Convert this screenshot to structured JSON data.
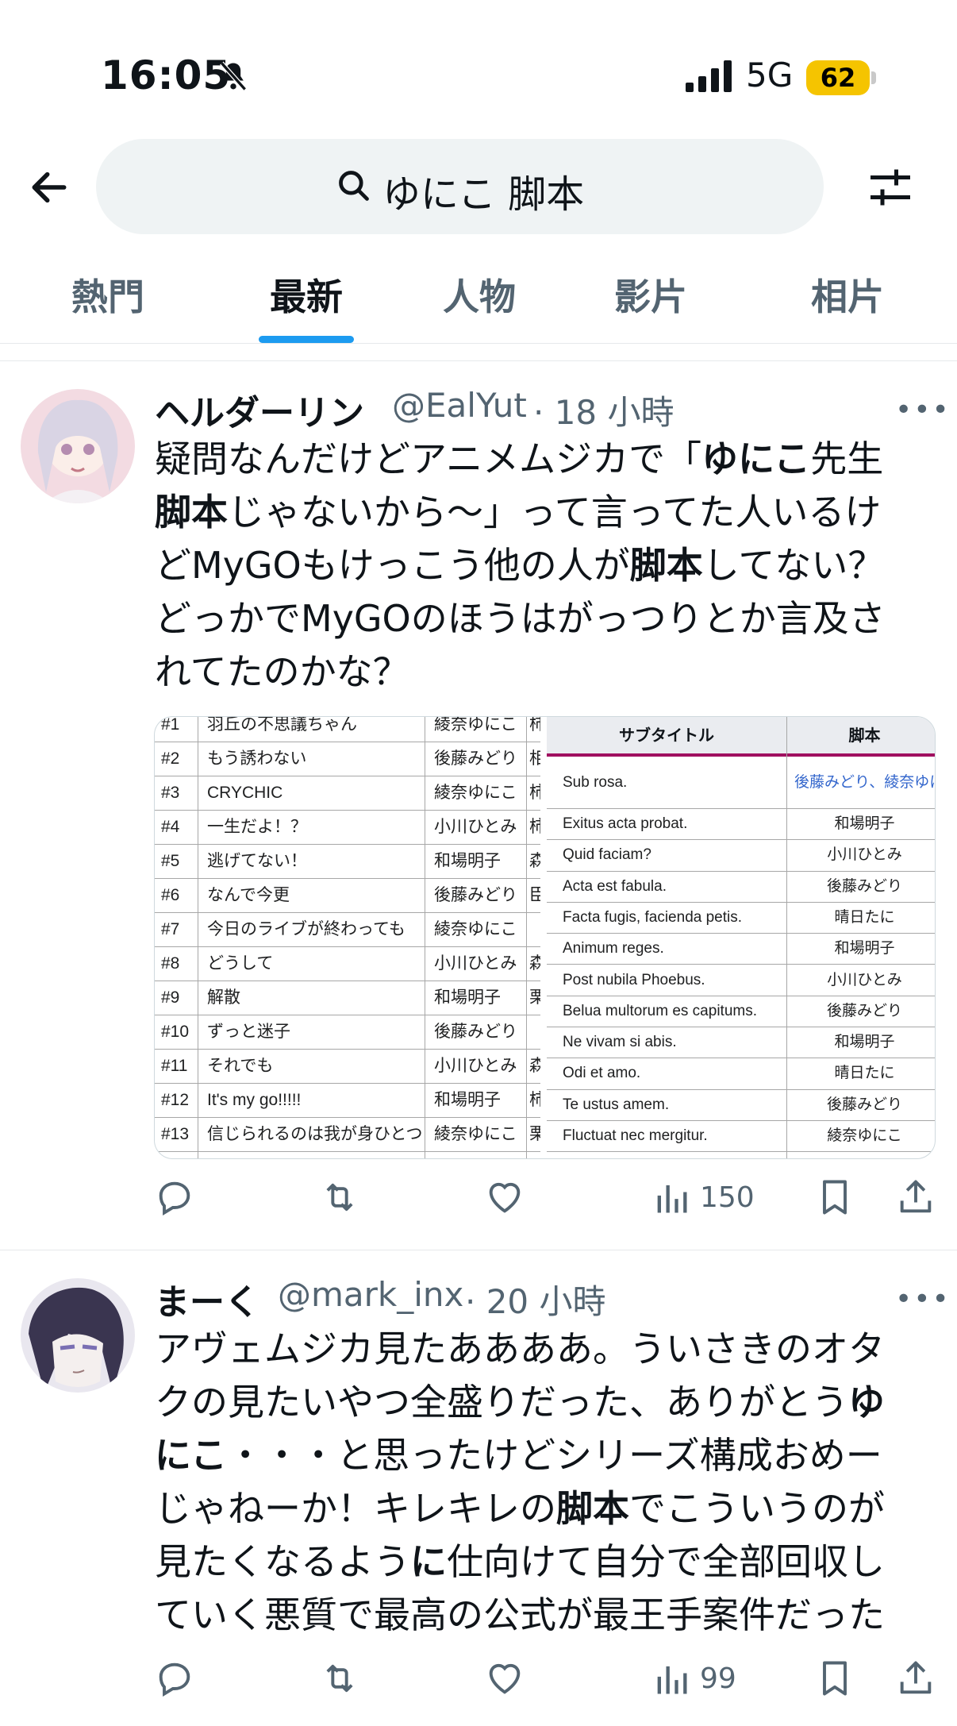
{
  "status_bar": {
    "time": "16:05",
    "network": "5G",
    "battery": "62"
  },
  "search": {
    "query": "ゆにこ 脚本"
  },
  "tabs": [
    {
      "label": "熱門"
    },
    {
      "label": "最新",
      "active": true
    },
    {
      "label": "人物"
    },
    {
      "label": "影片"
    },
    {
      "label": "相片"
    }
  ],
  "tweets": [
    {
      "name": "ヘルダーリン",
      "handle": "@EalYut",
      "time": "· 18 小時",
      "body_lines": [
        [
          {
            "t": "疑問なんだけどアニメムジカで「"
          },
          {
            "t": "ゆにこ",
            "b": true
          },
          {
            "t": "先生"
          }
        ],
        [
          {
            "t": "脚本",
            "b": true
          },
          {
            "t": "じゃないから～」って言ってた人いるけ"
          }
        ],
        [
          {
            "t": "どMyGOもけっこう他の人が"
          },
          {
            "t": "脚本",
            "b": true
          },
          {
            "t": "してない？"
          }
        ],
        [
          {
            "t": "どっかでMyGOのほうはがっつりとか言及さ"
          }
        ],
        [
          {
            "t": "れてたのかな？"
          }
        ]
      ],
      "views": "150",
      "media": {
        "left_table": [
          [
            "#1",
            "羽丘の不思議ちゃん",
            "綾奈ゆにこ",
            "柿"
          ],
          [
            "#2",
            "もう誘わない",
            "後藤みどり",
            "相"
          ],
          [
            "#3",
            "CRYCHIC",
            "綾奈ゆにこ",
            "柿"
          ],
          [
            "#4",
            "一生だよ！？",
            "小川ひとみ",
            "柿"
          ],
          [
            "#5",
            "逃げてない！",
            "和場明子",
            "森"
          ],
          [
            "#6",
            "なんで今更",
            "後藤みどり",
            "臣"
          ],
          [
            "#7",
            "今日のライブが終わっても",
            "綾奈ゆにこ",
            ""
          ],
          [
            "#8",
            "どうして",
            "小川ひとみ",
            "森"
          ],
          [
            "#9",
            "解散",
            "和場明子",
            "栗"
          ],
          [
            "#10",
            "ずっと迷子",
            "後藤みどり",
            ""
          ],
          [
            "#11",
            "それでも",
            "小川ひとみ",
            "森"
          ],
          [
            "#12",
            "It's my go!!!!!",
            "和場明子",
            "柿"
          ],
          [
            "#13",
            "信じられるのは我が身ひとつ",
            "綾奈ゆにこ",
            "栗"
          ]
        ],
        "right_table": {
          "headers": [
            "サブタイトル",
            "脚本"
          ],
          "rows": [
            [
              "Sub rosa.",
              "後藤みどり、綾奈ゆに"
            ],
            [
              "Exitus acta probat.",
              "和場明子"
            ],
            [
              "Quid faciam?",
              "小川ひとみ"
            ],
            [
              "Acta est fabula.",
              "後藤みどり"
            ],
            [
              "Facta fugis, facienda petis.",
              "晴日たに"
            ],
            [
              "Animum reges.",
              "和場明子"
            ],
            [
              "Post nubila Phoebus.",
              "小川ひとみ"
            ],
            [
              "Belua multorum es capitums.",
              "後藤みどり"
            ],
            [
              "Ne vivam si abis.",
              "和場明子"
            ],
            [
              "Odi et amo.",
              "晴日たに"
            ],
            [
              "Te ustus amem.",
              "後藤みどり"
            ],
            [
              "Fluctuat nec mergitur.",
              "綾奈ゆにこ"
            ]
          ]
        }
      }
    },
    {
      "name": "まーく",
      "handle": "@mark_inx",
      "time": "· 20 小時",
      "body_lines": [
        [
          {
            "t": "アヴェムジカ見たああああ。ういさきのオタ"
          }
        ],
        [
          {
            "t": "クの見たいやつ全盛りだった、ありがとう"
          },
          {
            "t": "ゆ",
            "b": true
          }
        ],
        [
          {
            "t": "にこ",
            "b": true
          },
          {
            "t": "・・・と思ったけどシリーズ構成おめー"
          }
        ],
        [
          {
            "t": "じゃねーか！キレキレの"
          },
          {
            "t": "脚本",
            "b": true
          },
          {
            "t": "でこういうのが"
          }
        ],
        [
          {
            "t": "見たくなるよう"
          },
          {
            "t": "に",
            "b": true
          },
          {
            "t": "仕向けて自分で全部回収し"
          }
        ],
        [
          {
            "t": "ていく悪質で最高の公式が最王手案件だった"
          }
        ]
      ],
      "views": "99"
    }
  ]
}
